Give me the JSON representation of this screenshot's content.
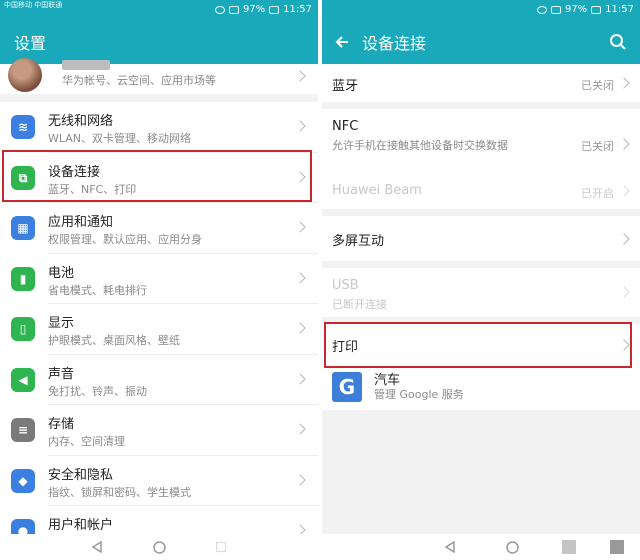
{
  "colors": {
    "accent": "#1aa9bb",
    "highlight": "#c9262d"
  },
  "left": {
    "status": {
      "carrier": "中国移动 中国联通",
      "battery": "97%",
      "time": "11:57"
    },
    "title": "设置",
    "account": {
      "subtitle": "华为帐号、云空间、应用市场等"
    },
    "items": [
      {
        "title": "无线和网络",
        "subtitle": "WLAN、双卡管理、移动网络",
        "icon": "wifi-icon",
        "color": "#3b7fe0"
      },
      {
        "title": "设备连接",
        "subtitle": "蓝牙、NFC、打印",
        "icon": "device-connect-icon",
        "color": "#2fb54f"
      },
      {
        "title": "应用和通知",
        "subtitle": "权限管理、默认应用、应用分身",
        "icon": "apps-icon",
        "color": "#3b7fe0"
      },
      {
        "title": "电池",
        "subtitle": "省电模式、耗电排行",
        "icon": "battery-icon",
        "color": "#2fb54f"
      },
      {
        "title": "显示",
        "subtitle": "护眼模式、桌面风格、壁纸",
        "icon": "display-icon",
        "color": "#2fb54f"
      },
      {
        "title": "声音",
        "subtitle": "免打扰、铃声、振动",
        "icon": "sound-icon",
        "color": "#2fb54f"
      },
      {
        "title": "存储",
        "subtitle": "内存、空间清理",
        "icon": "storage-icon",
        "color": "#7a7a7a"
      },
      {
        "title": "安全和隐私",
        "subtitle": "指纹、锁屏和密码、学生模式",
        "icon": "shield-icon",
        "color": "#3b7fe0"
      },
      {
        "title": "用户和帐户",
        "subtitle": "",
        "icon": "user-icon",
        "color": "#3b7fe0"
      }
    ]
  },
  "right": {
    "status": {
      "battery": "97%",
      "time": "11:57"
    },
    "title": "设备连接",
    "bluetooth": {
      "title": "蓝牙",
      "value": "已关闭"
    },
    "nfc": {
      "title": "NFC",
      "subtitle": "允许手机在接触其他设备时交换数据",
      "value": "已关闭"
    },
    "beam": {
      "title": "Huawei Beam",
      "value": "已开启"
    },
    "multiscreen": {
      "title": "多屏互动"
    },
    "usb": {
      "title": "USB",
      "subtitle": "已断开连接"
    },
    "print": {
      "title": "打印"
    },
    "car": {
      "title": "汽车",
      "subtitle": "管理 Google 服务",
      "icon_letter": "G"
    }
  }
}
